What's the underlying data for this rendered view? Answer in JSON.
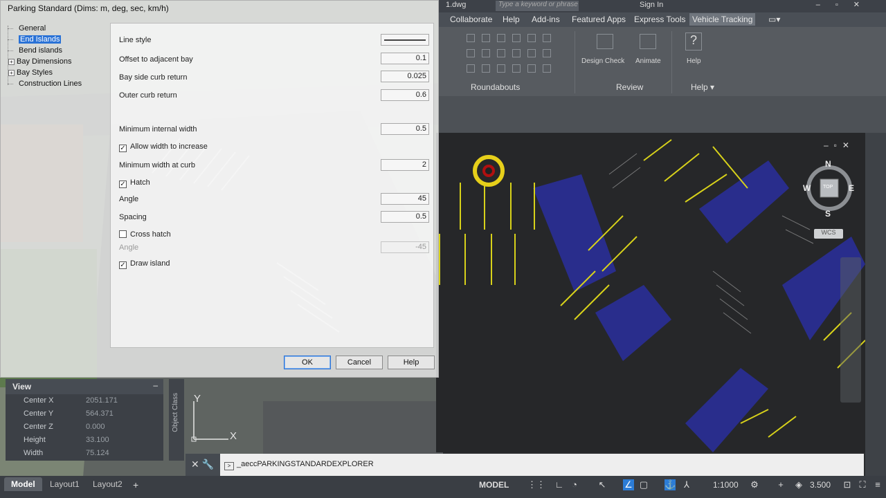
{
  "dialog": {
    "title": "Parking Standard    (Dims: m, deg, sec, km/h)",
    "tree": [
      {
        "label": "General",
        "selected": false,
        "expandable": false
      },
      {
        "label": "End Islands",
        "selected": true,
        "expandable": false
      },
      {
        "label": "Bend islands",
        "selected": false,
        "expandable": false
      },
      {
        "label": "Bay Dimensions",
        "selected": false,
        "expandable": true
      },
      {
        "label": "Bay Styles",
        "selected": false,
        "expandable": true
      },
      {
        "label": "Construction Lines",
        "selected": false,
        "expandable": false
      }
    ],
    "props": {
      "line_style": {
        "label": "Line style"
      },
      "offset_bay": {
        "label": "Offset to adjacent bay",
        "value": "0.1"
      },
      "bay_side_curb": {
        "label": "Bay side curb return",
        "value": "0.025"
      },
      "outer_curb": {
        "label": "Outer curb return",
        "value": "0.6"
      },
      "min_internal": {
        "label": "Minimum internal width",
        "value": "0.5"
      },
      "allow_width": {
        "label": "Allow width to increase",
        "checked": true
      },
      "min_width_curb": {
        "label": "Minimum width at curb",
        "value": "2"
      },
      "hatch": {
        "label": "Hatch",
        "checked": true
      },
      "angle": {
        "label": "Angle",
        "value": "45"
      },
      "spacing": {
        "label": "Spacing",
        "value": "0.5"
      },
      "cross_hatch": {
        "label": "Cross hatch",
        "checked": false
      },
      "angle2": {
        "label": "Angle",
        "value": "-45"
      },
      "draw_island": {
        "label": "Draw island",
        "checked": true
      }
    },
    "buttons": {
      "ok": "OK",
      "cancel": "Cancel",
      "help": "Help"
    }
  },
  "app": {
    "filename": "1.dwg",
    "search_placeholder": "Type a keyword or phrase",
    "signin": "Sign In",
    "tabs": [
      "Collaborate",
      "Help",
      "Add-ins",
      "Featured Apps",
      "Express Tools",
      "Vehicle Tracking"
    ],
    "active_tab": "Vehicle Tracking",
    "ribbon_groups": {
      "roundabouts": "Roundabouts",
      "review": "Review",
      "help": "Help ▾"
    },
    "ribbon_labels": {
      "design_check": "Design Check",
      "animate": "Animate",
      "help": "Help"
    }
  },
  "palette": {
    "title": "View",
    "rows": [
      {
        "key": "Center X",
        "value": "2051.171"
      },
      {
        "key": "Center Y",
        "value": "564.371"
      },
      {
        "key": "Center Z",
        "value": "0.000"
      },
      {
        "key": "Height",
        "value": "33.100"
      },
      {
        "key": "Width",
        "value": "75.124"
      }
    ],
    "side_label": "Object Class"
  },
  "viewcube": {
    "n": "N",
    "s": "S",
    "e": "E",
    "w": "W",
    "top": "TOP",
    "wcs": "WCS"
  },
  "ucs": {
    "x": "X",
    "y": "Y"
  },
  "command": {
    "text": "_aeccPARKINGSTANDARDEXPLORER"
  },
  "statusbar": {
    "layouts": [
      "Model",
      "Layout1",
      "Layout2"
    ],
    "add": "+",
    "model": "MODEL",
    "scale": "1:1000",
    "value": "3.500"
  },
  "colors": {
    "accent": "#2a72d6",
    "hatch": "#2a2f9e",
    "lines": "#d8d21a"
  }
}
